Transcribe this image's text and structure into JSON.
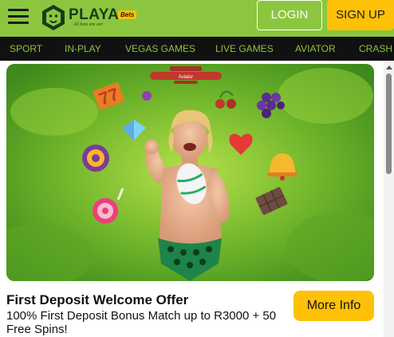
{
  "header": {
    "logo_text": "PLAYA",
    "logo_badge": "Bets",
    "logo_tagline": "All bets are on!",
    "login_label": "LOGIN",
    "signup_label": "SIGN UP"
  },
  "nav": {
    "items": [
      "SPORT",
      "IN-PLAY",
      "VEGAS GAMES",
      "LIVE GAMES",
      "AVIATOR",
      "CRASH G"
    ]
  },
  "banner": {
    "plane_text": "Aviator"
  },
  "promo": {
    "title": "First Deposit Welcome Offer",
    "description": "100% First Deposit Bonus Match up to R3000 + 50 Free Spins!",
    "button_label": "More Info"
  },
  "colors": {
    "brand_green": "#8cc63f",
    "accent_yellow": "#ffc107",
    "nav_bg": "#111111"
  }
}
